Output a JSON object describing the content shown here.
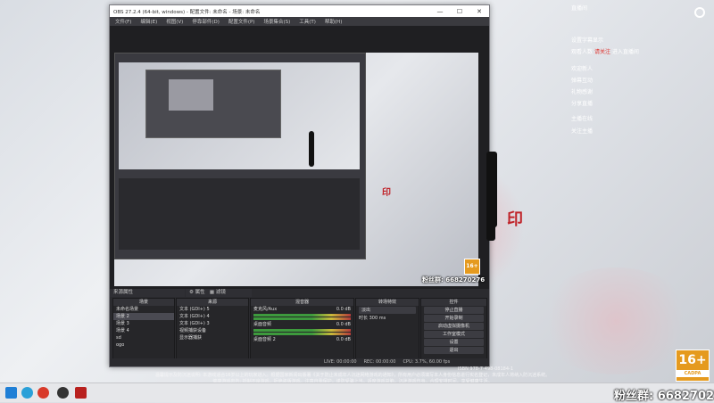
{
  "obs": {
    "title": "OBS 27.2.4 (64-bit, windows) - 配置文件: 未命名 - 场景: 未命名",
    "menu": [
      "文件(F)",
      "编辑(E)",
      "视图(V)",
      "停靠部件(D)",
      "配置文件(P)",
      "场景集合(S)",
      "工具(T)",
      "帮助(H)"
    ],
    "preview_caption": "来源属性",
    "scenes_header": "场景",
    "scenes": [
      "未命名场景",
      "场景 2",
      "场景 3",
      "场景 4",
      "sd",
      "ogo"
    ],
    "sources_header": "来源",
    "sources": [
      "文本 (GDI+) 5",
      "文本 (GDI+) 4",
      "文本 (GDI+) 3",
      "视频捕获设备",
      "显示器捕获"
    ],
    "mixer_header": "混音器",
    "mixer": [
      {
        "label": "麦克风/Aux",
        "db": "0.0 dB"
      },
      {
        "label": "桌面音频",
        "db": "0.0 dB"
      },
      {
        "label": "桌面音频 2",
        "db": "0.0 dB"
      }
    ],
    "transition_header": "转场特效",
    "transition_value": "淡出",
    "duration_label": "时长",
    "duration_value": "300 ms",
    "controls_header": "控件",
    "controls": [
      "停止直播",
      "开始录制",
      "启动虚拟摄像机",
      "工作室模式",
      "设置",
      "退出"
    ],
    "status": [
      "LIVE: 00:00:00",
      "REC: 00:00:00",
      "CPU: 3.7%, 60.00 fps"
    ]
  },
  "overlay": {
    "lines": [
      "直播间",
      "设置字幕显示",
      "观看人数",
      "进入直播间",
      "欢迎新人",
      "弹幕互动",
      "礼物感谢",
      "分享直播",
      "主播在线",
      "关注主播"
    ],
    "red_text": "请关注"
  },
  "notice": {
    "line1": "温馨提示及防沉迷说明: 本游戏适合16岁以上的玩家进入。根据国家新闻出版署《关于防止未成年人沉迷网络游戏的通知》，所有用户必须填写本人身份信息进行实名登记，未成年人将纳入防沉迷系统。",
    "line2": "健康游戏忠告: 抵制不良游戏，拒绝盗版游戏。注意自我保护，谨防受骗上当。适度游戏益脑，沉迷游戏伤身。合理安排时间，享受健康生活。",
    "isbn": "ISBN 978-7-498-08184-1"
  },
  "badge": {
    "age": "16+",
    "sub": "CADPA"
  },
  "fans": {
    "text": "粉丝群: 668270276",
    "small": "粉丝群: 668270276"
  },
  "colors": {
    "accent": "#e59a1e",
    "seal": "#c0242a",
    "obs_bg": "#2b2b2f"
  }
}
